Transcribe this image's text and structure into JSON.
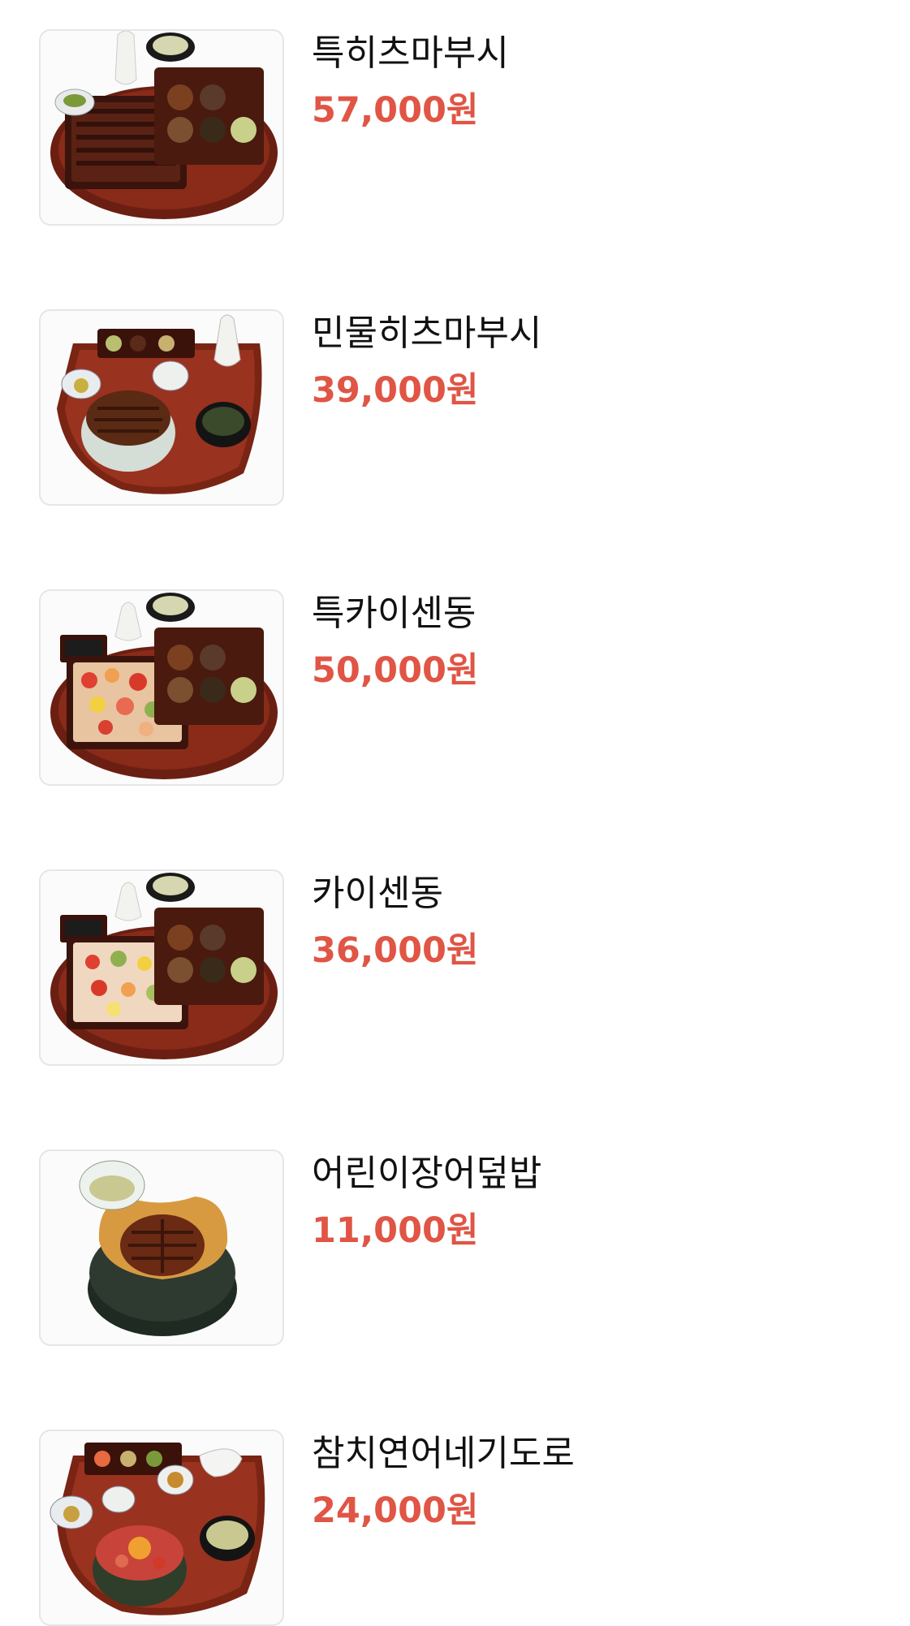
{
  "menu": {
    "items": [
      {
        "name": "특히츠마부시",
        "price": "57,000원",
        "image": "boxed-eel-set-photo"
      },
      {
        "name": "민물히츠마부시",
        "price": "39,000원",
        "image": "eel-bowl-set-photo"
      },
      {
        "name": "특카이센동",
        "price": "50,000원",
        "image": "boxed-sashimi-set-photo"
      },
      {
        "name": "카이센동",
        "price": "36,000원",
        "image": "sashimi-set-photo"
      },
      {
        "name": "어린이장어덮밥",
        "price": "11,000원",
        "image": "kids-eel-bowl-photo"
      },
      {
        "name": "참치연어네기도로",
        "price": "24,000원",
        "image": "tuna-salmon-bowl-set-photo"
      }
    ]
  },
  "colors": {
    "price": "#e05545",
    "name": "#111111",
    "thumb_border": "#e6e6e6"
  }
}
